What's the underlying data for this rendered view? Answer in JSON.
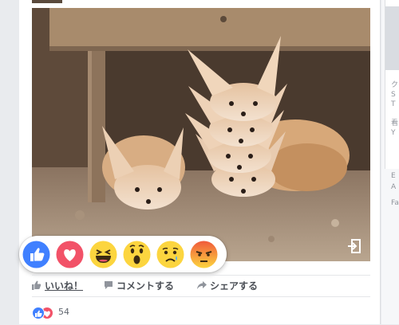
{
  "post": {
    "image_alt": "fennec-foxes-photo"
  },
  "reactions": [
    {
      "name": "like",
      "color": "#4080ff"
    },
    {
      "name": "love",
      "color": "#f25268"
    },
    {
      "name": "haha",
      "color": "#fcd53f"
    },
    {
      "name": "wow",
      "color": "#fcd53f"
    },
    {
      "name": "sad",
      "color": "#fcd53f"
    },
    {
      "name": "angry",
      "color": "#f7714c"
    }
  ],
  "actions": {
    "like_label": "いいね！",
    "comment_label": "コメントする",
    "share_label": "シェアする"
  },
  "summary": {
    "reaction_count": "54"
  },
  "side": {
    "lines": [
      "ク",
      "S",
      "T",
      "",
      "看",
      "Y",
      "",
      "E",
      "A",
      "Fa"
    ]
  }
}
